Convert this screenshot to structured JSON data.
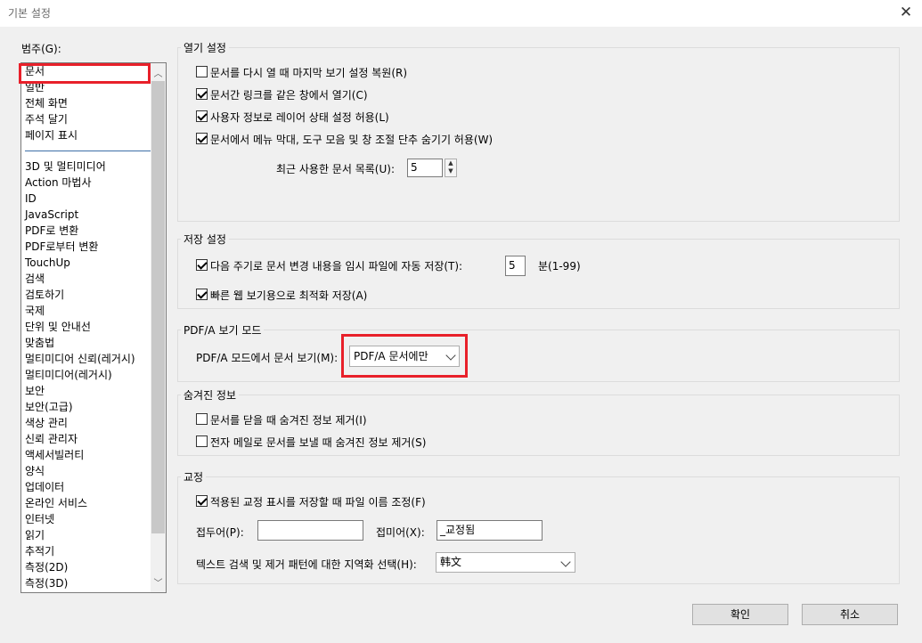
{
  "window": {
    "title": "기본 설정",
    "close_glyph": "✕"
  },
  "categories": {
    "label": "범주(G):",
    "group1": [
      "문서",
      "일반",
      "전체 화면",
      "주석 달기",
      "페이지 표시"
    ],
    "group2": [
      "3D 및 멀티미디어",
      "Action 마법사",
      "ID",
      "JavaScript",
      "PDF로 변환",
      "PDF로부터 변환",
      "TouchUp",
      "검색",
      "검토하기",
      "국제",
      "단위 및 안내선",
      "맞춤법",
      "멀티미디어 신뢰(레거시)",
      "멀티미디어(레거시)",
      "보안",
      "보안(고급)",
      "색상 관리",
      "신뢰 관리자",
      "액세서빌러티",
      "양식",
      "업데이터",
      "온라인 서비스",
      "인터넷",
      "읽기",
      "추적기",
      "측정(2D)",
      "측정(3D)"
    ],
    "selected": "문서"
  },
  "open_settings": {
    "title": "열기 설정",
    "restore_view": {
      "label": "문서를 다시 열 때 마지막 보기 설정 복원(R)",
      "checked": false
    },
    "cross_doc_links": {
      "label": "문서간 링크를 같은 창에서 열기(C)",
      "checked": true
    },
    "layer_state": {
      "label": "사용자 정보로 레이어 상태 설정 허용(L)",
      "checked": true
    },
    "hide_menu": {
      "label": "문서에서 메뉴 막대, 도구 모음 및 창 조절 단추 숨기기 허용(W)",
      "checked": true
    },
    "recent_docs": {
      "label": "최근 사용한 문서 목록(U):",
      "value": "5"
    }
  },
  "save_settings": {
    "title": "저장 설정",
    "autosave": {
      "label": "다음 주기로 문서 변경 내용을 임시 파일에 자동 저장(T):",
      "checked": true,
      "value": "5",
      "unit": "분(1-99)"
    },
    "fast_web": {
      "label": "빠른 웹 보기용으로 최적화 저장(A)",
      "checked": true
    }
  },
  "pdfa": {
    "title": "PDF/A 보기 모드",
    "label": "PDF/A 모드에서 문서 보기(M):",
    "value": "PDF/A 문서에만"
  },
  "hidden_info": {
    "title": "숨겨진 정보",
    "remove_on_close": {
      "label": "문서를 닫을 때 숨겨진 정보 제거(I)",
      "checked": false
    },
    "remove_on_email": {
      "label": "전자 메일로 문서를 보낼 때 숨겨진 정보 제거(S)",
      "checked": false
    }
  },
  "redaction": {
    "title": "교정",
    "adjust_filename": {
      "label": "적용된 교정 표시를 저장할 때 파일 이름 조정(F)",
      "checked": true
    },
    "prefix": {
      "label": "접두어(P):",
      "value": ""
    },
    "suffix": {
      "label": "접미어(X):",
      "value": "_교정됨"
    },
    "locale": {
      "label": "텍스트 검색 및 제거 패턴에 대한 지역화 선택(H):",
      "value": "韩文"
    }
  },
  "buttons": {
    "ok": "확인",
    "cancel": "취소"
  },
  "colors": {
    "highlight": "#e8202a",
    "separator": "#3c6fa6"
  }
}
